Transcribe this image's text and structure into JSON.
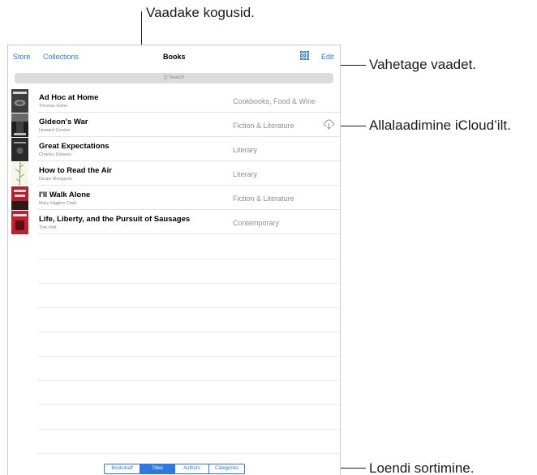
{
  "callouts": {
    "collections": "Vaadake kogusid.",
    "switch_view": "Vahetage vaadet.",
    "icloud": "Allalaadimine iCloud’ilt.",
    "sort": "Loendi sortimine."
  },
  "navbar": {
    "store": "Store",
    "collections": "Collections",
    "title": "Books",
    "edit": "Edit"
  },
  "search": {
    "placeholder": "Q Search"
  },
  "books": [
    {
      "title": "Ad Hoc at Home",
      "author": "Thomas Keller",
      "category": "Cookbooks, Food & Wine"
    },
    {
      "title": "Gideon's War",
      "author": "Howard Gordon",
      "category": "Fiction & Literature"
    },
    {
      "title": "Great Expectations",
      "author": "Charles Dickens",
      "category": "Literary"
    },
    {
      "title": "How to Read the Air",
      "author": "Dinaw Mengestu",
      "category": "Literary"
    },
    {
      "title": "I'll Walk Alone",
      "author": "Mary Higgins Clark",
      "category": "Fiction & Literature"
    },
    {
      "title": "Life, Liberty, and the Pursuit of Sausages",
      "author": "Tom Holt",
      "category": "Contemporary"
    }
  ],
  "sort_tabs": [
    "Bookshelf",
    "Titles",
    "Authors",
    "Categories"
  ],
  "active_sort": "Titles",
  "colors": {
    "accent": "#2a7ae2"
  }
}
